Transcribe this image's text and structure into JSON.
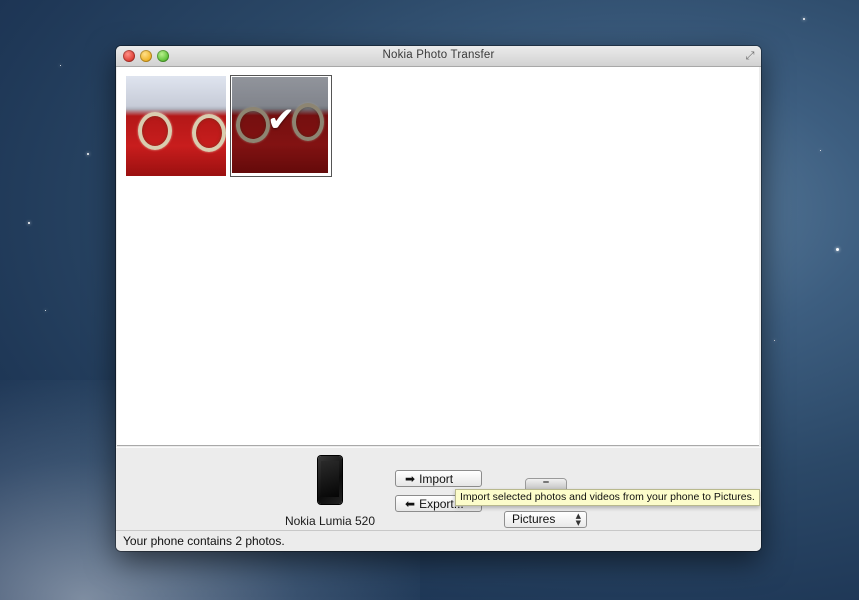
{
  "window": {
    "title": "Nokia Photo Transfer"
  },
  "photos": [
    {
      "name": "rings-photo-1",
      "selected": false
    },
    {
      "name": "rings-photo-2",
      "selected": true
    }
  ],
  "device": {
    "name": "Nokia Lumia 520",
    "icon": "phone-icon"
  },
  "actions": {
    "import_label": "Import",
    "export_label": "Export...",
    "import_icon": "right-arrow-icon",
    "export_icon": "left-arrow-icon"
  },
  "tooltip": {
    "text": "Import selected photos and videos from your phone to Pictures."
  },
  "destination": {
    "icon": "mac-mini-icon",
    "selected": "Pictures"
  },
  "status": {
    "text": "Your phone contains 2 photos."
  }
}
